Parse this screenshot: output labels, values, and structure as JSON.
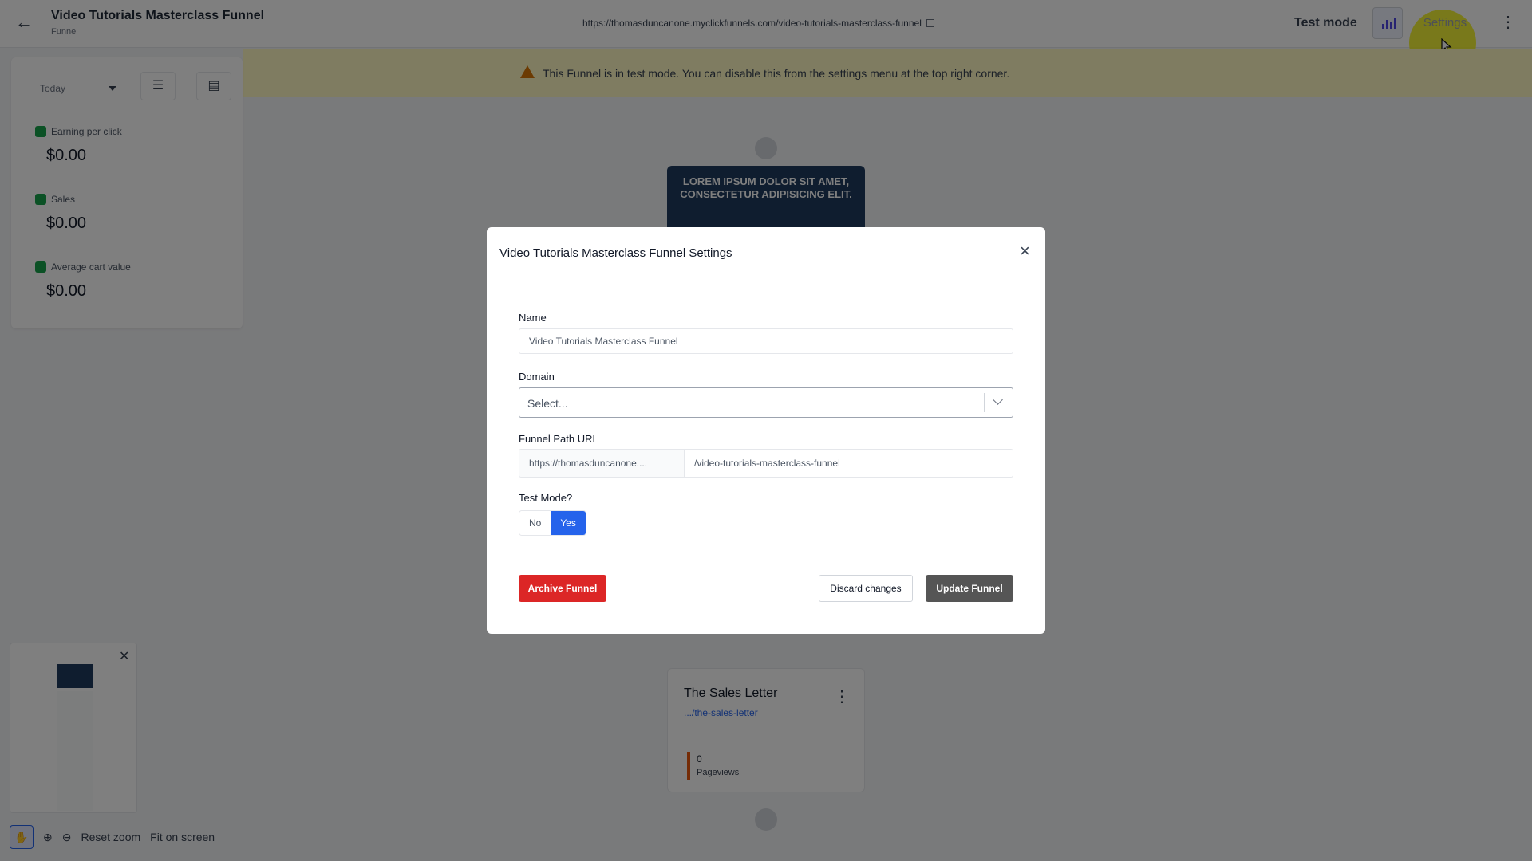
{
  "header": {
    "title": "Video Tutorials Masterclass Funnel",
    "subtitle": "Funnel",
    "url": "https://thomasduncanone.myclickfunnels.com/video-tutorials-masterclass-funnel",
    "test_mode_label": "Test mode",
    "settings_label": "Settings"
  },
  "banner": {
    "text": "This Funnel is in test mode. You can disable this from the settings menu at the top right corner."
  },
  "stats": {
    "date_range": "Today",
    "items": [
      {
        "label": "Earning per click",
        "value": "$0.00"
      },
      {
        "label": "Sales",
        "value": "$0.00"
      },
      {
        "label": "Average cart value",
        "value": "$0.00"
      }
    ]
  },
  "canvas": {
    "optin_thumbnail_text": "LOREM IPSUM DOLOR SIT AMET, CONSECTETUR ADIPISICING ELIT.",
    "sales_step": {
      "title": "The Sales Letter",
      "path": ".../the-sales-letter",
      "pageviews_value": "0",
      "pageviews_label": "Pageviews"
    }
  },
  "zoom": {
    "reset_label": "Reset zoom",
    "fit_label": "Fit on screen"
  },
  "modal": {
    "title": "Video Tutorials Masterclass Funnel Settings",
    "name_label": "Name",
    "name_value": "Video Tutorials Masterclass Funnel",
    "domain_label": "Domain",
    "domain_placeholder": "Select...",
    "path_label": "Funnel Path URL",
    "path_prefix": "https://thomasduncanone....",
    "path_value": "/video-tutorials-masterclass-funnel",
    "test_mode_label": "Test Mode?",
    "toggle_no": "No",
    "toggle_yes": "Yes",
    "archive_label": "Archive Funnel",
    "discard_label": "Discard changes",
    "update_label": "Update Funnel"
  },
  "colors": {
    "accent": "#2563eb",
    "danger": "#dc2626",
    "banner": "#fef9c3"
  }
}
